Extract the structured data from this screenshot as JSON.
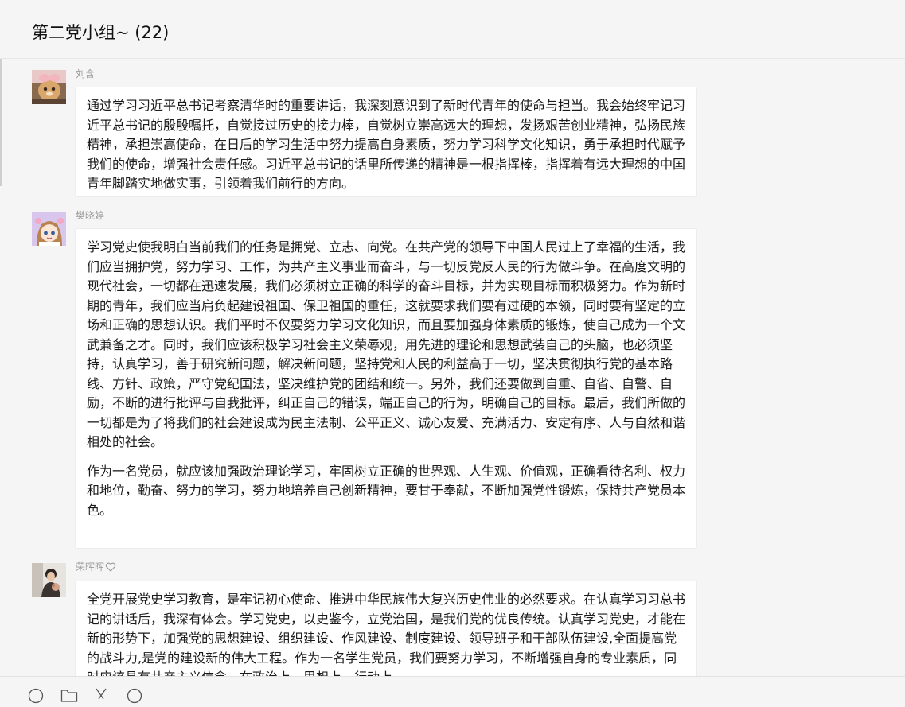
{
  "chat": {
    "title": "第二党小组~ (22)"
  },
  "messages": [
    {
      "sender": "刘含",
      "paragraphs": [
        "通过学习习近平总书记考察清华时的重要讲话，我深刻意识到了新时代青年的使命与担当。我会始终牢记习近平总书记的殷殷嘱托，自觉接过历史的接力棒，自觉树立崇高远大的理想，发扬艰苦创业精神，弘扬民族精神，承担崇高使命，在日后的学习生活中努力提高自身素质，努力学习科学文化知识，勇于承担时代赋予我们的使命，增强社会责任感。习近平总书记的话里所传递的精神是一根指挥棒，指挥着有远大理想的中国青年脚踏实地做实事，引领着我们前行的方向。"
      ]
    },
    {
      "sender": "樊晓婷",
      "paragraphs": [
        "学习党史使我明白当前我们的任务是拥党、立志、向党。在共产党的领导下中国人民过上了幸福的生活，我们应当拥护党，努力学习、工作，为共产主义事业而奋斗，与一切反党反人民的行为做斗争。在高度文明的现代社会，一切都在迅速发展，我们必须树立正确的科学的奋斗目标，并为实现目标而积极努力。作为新时期的青年，我们应当肩负起建设祖国、保卫祖国的重任，这就要求我们要有过硬的本领，同时要有坚定的立场和正确的思想认识。我们平时不仅要努力学习文化知识，而且要加强身体素质的锻炼，使自己成为一个文武兼备之才。同时，我们应该积极学习社会主义荣辱观，用先进的理论和思想武装自己的头脑，也必须坚持，认真学习，善于研究新问题，解决新问题，坚持党和人民的利益高于一切，坚决贯彻执行党的基本路线、方针、政策，严守党纪国法，坚决维护党的团结和统一。另外，我们还要做到自重、自省、自警、自励，不断的进行批评与自我批评，纠正自己的错误，端正自己的行为，明确自己的目标。最后，我们所做的一切都是为了将我们的社会建设成为民主法制、公平正义、诚心友爱、充满活力、安定有序、人与自然和谐相处的社会。",
        "作为一名党员，就应该加强政治理论学习，牢固树立正确的世界观、人生观、价值观，正确看待名利、权力和地位，勤奋、努力的学习，努力地培养自己创新精神，要甘于奉献，不断加强党性锻炼，保持共产党员本色。"
      ]
    },
    {
      "sender": "荣晖晖",
      "paragraphs": [
        "全党开展党史学习教育，是牢记初心使命、推进中华民族伟大复兴历史伟业的必然要求。在认真学习习总书记的讲话后，我深有体会。学习党史，以史鉴今，立党治国，是我们党的优良传统。认真学习党史，才能在新的形势下，加强党的思想建设、组织建设、作风建设、制度建设、领导班子和干部队伍建设,全面提高党的战斗力,是党的建设新的伟大工程。作为一名学生党员，我们要努力学习，不断增强自身的专业素质，同时应该具有共产主义信念，在政治上、思想上、行动上"
      ]
    }
  ],
  "icons": {
    "sender3_badge": "heart-icon",
    "toolbar": [
      "emoji-icon",
      "folder-icon",
      "scissors-icon",
      "chat-history-icon"
    ]
  }
}
